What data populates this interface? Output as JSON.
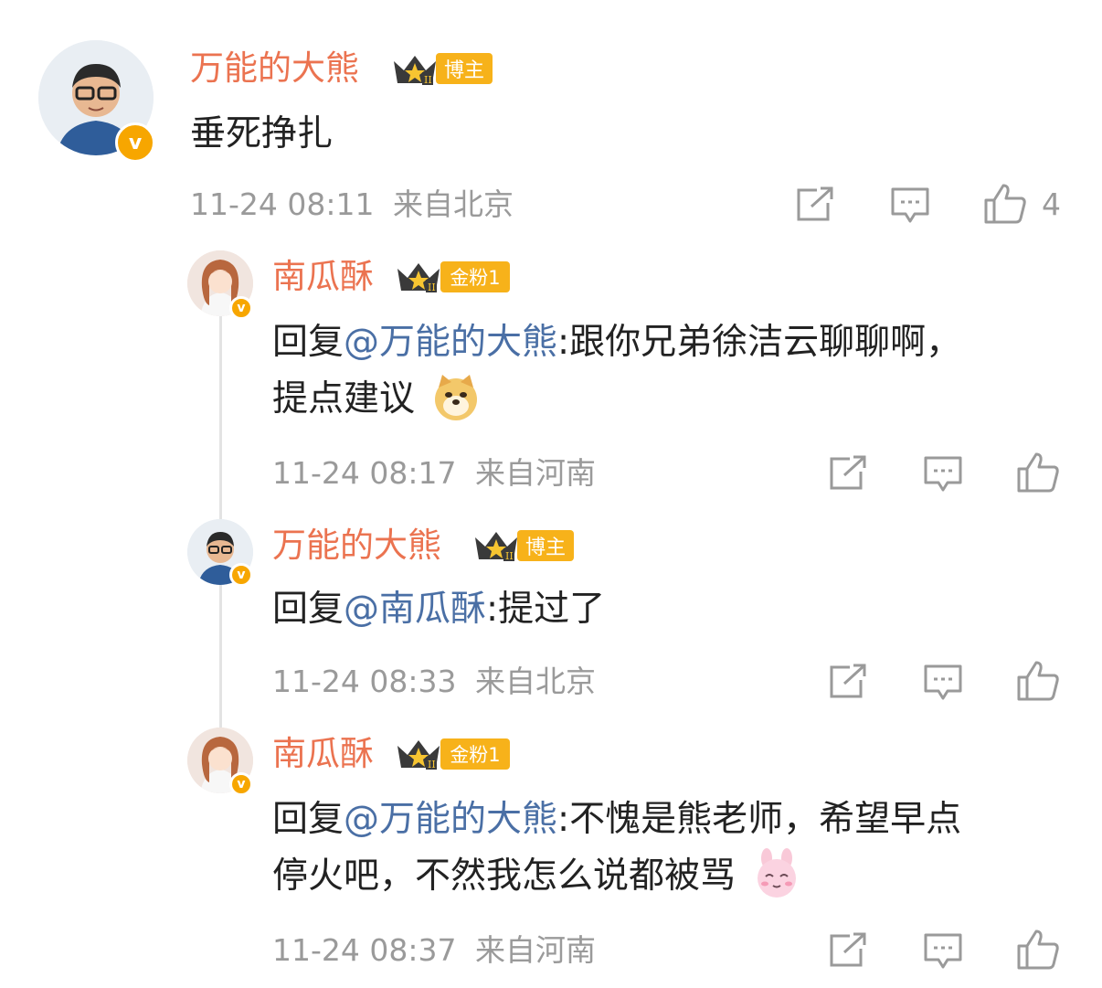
{
  "colors": {
    "name": "#eb7350",
    "mention": "#4a6fa5",
    "meta": "#9a9a9a",
    "tag_bg": "#f7b21a",
    "vbadge": "#f7a600"
  },
  "comment": {
    "author": "万能的大熊",
    "badge": "博主",
    "text": "垂死挣扎",
    "time": "11-24 08:11",
    "location": "来自北京",
    "like_count": "4",
    "icons": [
      "share-icon",
      "comment-icon",
      "like-icon"
    ]
  },
  "replies": [
    {
      "author": "南瓜酥",
      "badge": "金粉1",
      "reply_prefix": "回复",
      "mention": "@万能的大熊",
      "text_line1": ":跟你兄弟徐洁云聊聊啊，",
      "text_line2": "提点建议",
      "emoji": "doge-emoji",
      "time": "11-24 08:17",
      "location": "来自河南"
    },
    {
      "author": "万能的大熊",
      "badge": "博主",
      "reply_prefix": "回复",
      "mention": "@南瓜酥",
      "text_line1": ":提过了",
      "time": "11-24 08:33",
      "location": "来自北京"
    },
    {
      "author": "南瓜酥",
      "badge": "金粉1",
      "reply_prefix": "回复",
      "mention": "@万能的大熊",
      "text_line1": ":不愧是熊老师，希望早点",
      "text_line2": "停火吧，不然我怎么说都被骂",
      "emoji": "shy-bunny-emoji",
      "time": "11-24 08:37",
      "location": "来自河南"
    }
  ]
}
